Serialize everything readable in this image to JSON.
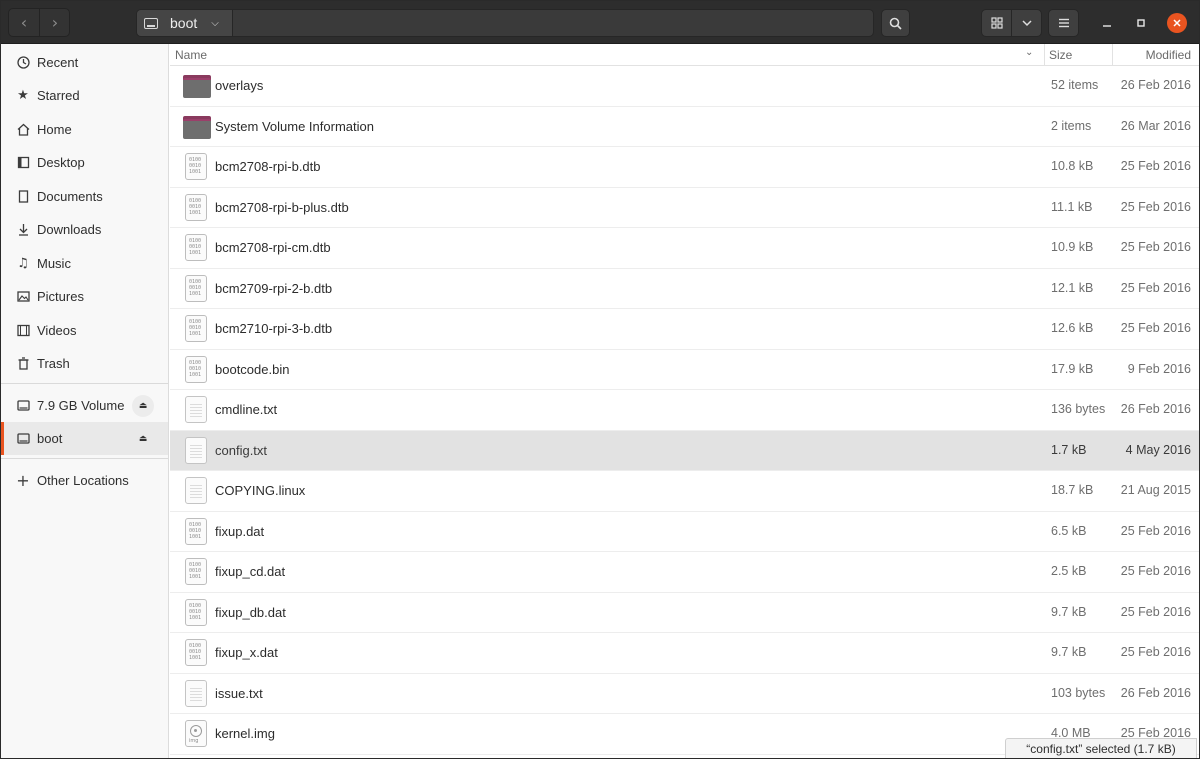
{
  "window": {
    "title": "boot"
  },
  "header": {
    "path_label": "boot",
    "back_icon": "chevron-left-icon",
    "forward_icon": "chevron-right-icon"
  },
  "sidebar": {
    "items": [
      {
        "label": "Recent",
        "icon": "clock-icon"
      },
      {
        "label": "Starred",
        "icon": "star-icon"
      },
      {
        "label": "Home",
        "icon": "home-icon"
      },
      {
        "label": "Desktop",
        "icon": "desktop-icon"
      },
      {
        "label": "Documents",
        "icon": "documents-icon"
      },
      {
        "label": "Downloads",
        "icon": "downloads-icon"
      },
      {
        "label": "Music",
        "icon": "music-icon"
      },
      {
        "label": "Pictures",
        "icon": "pictures-icon"
      },
      {
        "label": "Videos",
        "icon": "videos-icon"
      },
      {
        "label": "Trash",
        "icon": "trash-icon"
      }
    ],
    "volumes": [
      {
        "label": "7.9 GB Volume",
        "icon": "drive-icon"
      },
      {
        "label": "boot",
        "icon": "drive-icon",
        "active": true
      }
    ],
    "other_locations": "Other Locations"
  },
  "columns": {
    "name": "Name",
    "size": "Size",
    "modified": "Modified"
  },
  "files": [
    {
      "name": "overlays",
      "size": "52 items",
      "modified": "26 Feb 2016",
      "type": "folder"
    },
    {
      "name": "System Volume Information",
      "size": "2 items",
      "modified": "26 Mar 2016",
      "type": "folder"
    },
    {
      "name": "bcm2708-rpi-b.dtb",
      "size": "10.8 kB",
      "modified": "25 Feb 2016",
      "type": "binary"
    },
    {
      "name": "bcm2708-rpi-b-plus.dtb",
      "size": "11.1 kB",
      "modified": "25 Feb 2016",
      "type": "binary"
    },
    {
      "name": "bcm2708-rpi-cm.dtb",
      "size": "10.9 kB",
      "modified": "25 Feb 2016",
      "type": "binary"
    },
    {
      "name": "bcm2709-rpi-2-b.dtb",
      "size": "12.1 kB",
      "modified": "25 Feb 2016",
      "type": "binary"
    },
    {
      "name": "bcm2710-rpi-3-b.dtb",
      "size": "12.6 kB",
      "modified": "25 Feb 2016",
      "type": "binary"
    },
    {
      "name": "bootcode.bin",
      "size": "17.9 kB",
      "modified": "9 Feb 2016",
      "type": "binary"
    },
    {
      "name": "cmdline.txt",
      "size": "136 bytes",
      "modified": "26 Feb 2016",
      "type": "text"
    },
    {
      "name": "config.txt",
      "size": "1.7 kB",
      "modified": "4 May 2016",
      "type": "text",
      "selected": true
    },
    {
      "name": "COPYING.linux",
      "size": "18.7 kB",
      "modified": "21 Aug 2015",
      "type": "text"
    },
    {
      "name": "fixup.dat",
      "size": "6.5 kB",
      "modified": "25 Feb 2016",
      "type": "binary"
    },
    {
      "name": "fixup_cd.dat",
      "size": "2.5 kB",
      "modified": "25 Feb 2016",
      "type": "binary"
    },
    {
      "name": "fixup_db.dat",
      "size": "9.7 kB",
      "modified": "25 Feb 2016",
      "type": "binary"
    },
    {
      "name": "fixup_x.dat",
      "size": "9.7 kB",
      "modified": "25 Feb 2016",
      "type": "binary"
    },
    {
      "name": "issue.txt",
      "size": "103 bytes",
      "modified": "26 Feb 2016",
      "type": "text"
    },
    {
      "name": "kernel.img",
      "size": "4.0 MB",
      "modified": "25 Feb 2016",
      "type": "image"
    }
  ],
  "binary_glyph": [
    "0100",
    "0010",
    "1001"
  ],
  "image_tag": "img",
  "status": "“config.txt” selected  (1.7 kB)",
  "colors": {
    "accent": "#e95420",
    "folder_tab": "#8a3a5e",
    "header_bg": "#2d2d2d"
  }
}
